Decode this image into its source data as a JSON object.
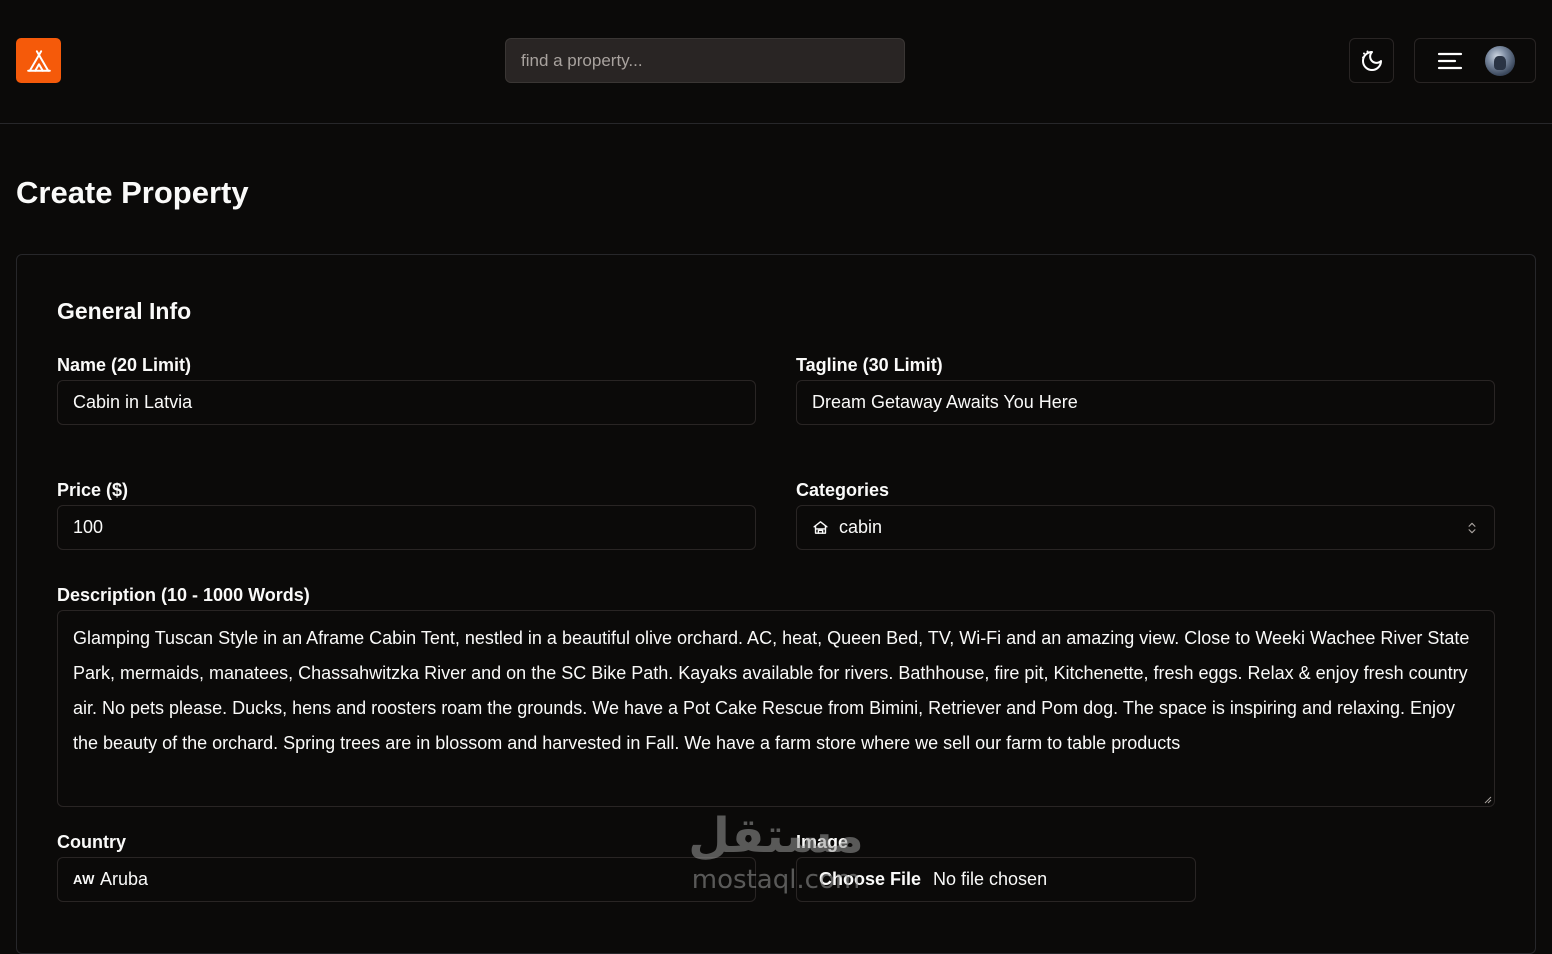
{
  "navbar": {
    "search": {
      "placeholder": "find a property..."
    }
  },
  "page": {
    "title": "Create Property",
    "section_title": "General Info"
  },
  "form": {
    "name": {
      "label": "Name (20 Limit)",
      "value": "Cabin in Latvia"
    },
    "tagline": {
      "label": "Tagline (30 Limit)",
      "value": "Dream Getaway Awaits You Here"
    },
    "price": {
      "label": "Price ($)",
      "value": "100"
    },
    "categories": {
      "label": "Categories",
      "value": "cabin"
    },
    "description": {
      "label": "Description (10 - 1000 Words)",
      "value": "Glamping Tuscan Style in an Aframe Cabin Tent, nestled in a beautiful olive orchard. AC, heat, Queen Bed, TV, Wi-Fi and an amazing view. Close to Weeki Wachee River State Park, mermaids, manatees, Chassahwitzka River and on the SC Bike Path. Kayaks available for rivers. Bathhouse, fire pit, Kitchenette, fresh eggs. Relax & enjoy fresh country air. No pets please. Ducks, hens and roosters roam the grounds. We have a Pot Cake Rescue from Bimini, Retriever and Pom dog. The space is inspiring and relaxing. Enjoy the beauty of the orchard. Spring trees are in blossom and harvested in Fall. We have a farm store where we sell our farm to table products"
    },
    "country": {
      "label": "Country",
      "code": "AW",
      "value": "Aruba"
    },
    "image": {
      "label": "Image",
      "button": "Choose File",
      "status": "No file chosen"
    }
  },
  "watermark": {
    "arabic": "مستقل",
    "latin": "mostaql.com"
  },
  "colors": {
    "background": "#0b0a09",
    "accent": "#f55a0a",
    "border": "#292524",
    "text": "#fafaf9"
  },
  "icons": {
    "logo": "tent-icon",
    "theme": "moon-icon",
    "menu": "menu-lines-icon",
    "category": "tent-icon",
    "select": "chevron-up-down-icon"
  }
}
